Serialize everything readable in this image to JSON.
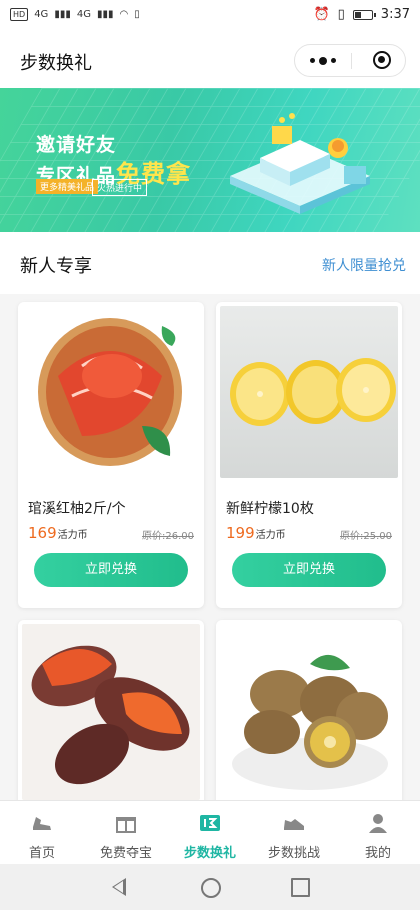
{
  "status_bar": {
    "time": "3:37",
    "network_labels": [
      "HD",
      "4G",
      "4G"
    ]
  },
  "title_bar": {
    "title": "步数换礼"
  },
  "banner": {
    "line1": "邀请好友",
    "line2_prefix": "专区礼品",
    "line2_highlight": "免费拿",
    "tag1": "更多精美礼品",
    "tag2": "火热进行中"
  },
  "section": {
    "title": "新人专享",
    "more_link": "新人限量抢兑",
    "products": [
      {
        "name": "琯溪红柚2斤/个",
        "price": "169",
        "unit": "活力币",
        "original": "原价:26.00",
        "button": "立即兑换"
      },
      {
        "name": "新鲜柠檬10枚",
        "price": "199",
        "unit": "活力币",
        "original": "原价:25.00",
        "button": "立即兑换"
      },
      {
        "name": "",
        "price": "",
        "unit": "",
        "original": "",
        "button": ""
      },
      {
        "name": "",
        "price": "",
        "unit": "",
        "original": "",
        "button": ""
      }
    ]
  },
  "tabbar": {
    "active_index": 2,
    "accent_color": "#1fb6a3",
    "tabs": [
      {
        "label": "首页",
        "icon": "shoe-icon"
      },
      {
        "label": "免费夺宝",
        "icon": "gift-icon"
      },
      {
        "label": "步数换礼",
        "icon": "exchange-icon"
      },
      {
        "label": "步数挑战",
        "icon": "sneaker-icon"
      },
      {
        "label": "我的",
        "icon": "user-icon"
      }
    ]
  }
}
